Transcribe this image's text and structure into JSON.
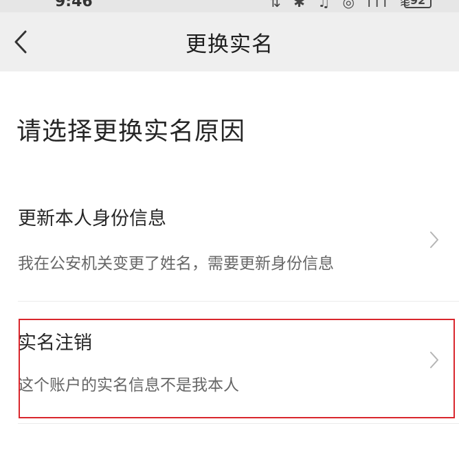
{
  "status_bar": {
    "time": "9:46",
    "indicators": "⇅ ✱ ♫ ◎ ıll ≋",
    "battery": "92"
  },
  "nav": {
    "title": "更换实名",
    "back_icon": "chevron-left-icon"
  },
  "main": {
    "heading": "请选择更换实名原因",
    "options": [
      {
        "title": "更新本人身份信息",
        "description": "我在公安机关变更了姓名，需要更新身份信息",
        "icon": "chevron-right-icon"
      },
      {
        "title": "实名注销",
        "description": "这个账户的实名信息不是我本人",
        "icon": "chevron-right-icon"
      }
    ]
  },
  "colors": {
    "nav_bg": "#efefef",
    "highlight": "#d9252b",
    "text_primary": "#262626",
    "text_secondary": "#666666"
  }
}
